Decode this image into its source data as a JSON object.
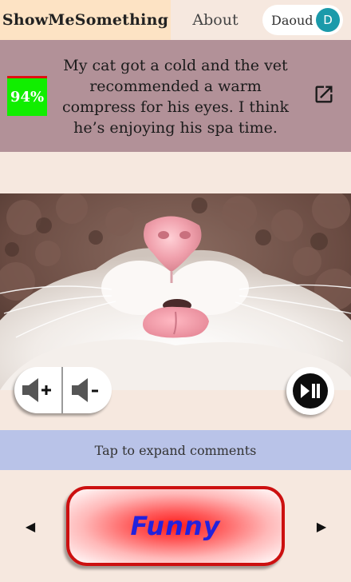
{
  "nav": {
    "brand": "ShowMeSomething",
    "about": "About",
    "user": {
      "name": "Daoud",
      "initial": "D",
      "avatar_color": "#1b9aaa"
    }
  },
  "post": {
    "score": "94%",
    "caption": "My cat got a cold and the vet recommended a warm compress for his eyes. I think he’s enjoying his spa time.",
    "open_icon": "open-in-new-icon"
  },
  "media": {
    "subject": "cat",
    "controls": {
      "volume_up": "volume-up-icon",
      "volume_down": "volume-down-icon",
      "play_pause": "play-pause-icon"
    }
  },
  "comments": {
    "label": "Tap to expand comments"
  },
  "reaction": {
    "prev": "◀",
    "label": "Funny",
    "next": "▶"
  },
  "colors": {
    "background": "#f6e8df",
    "brand_bg": "#fde3c4",
    "caption_bg": "#b29198",
    "score_bg": "#11ee00",
    "comments_bg": "#b9c3e8",
    "funny_border": "#cc1010",
    "funny_text": "#2222dd"
  }
}
